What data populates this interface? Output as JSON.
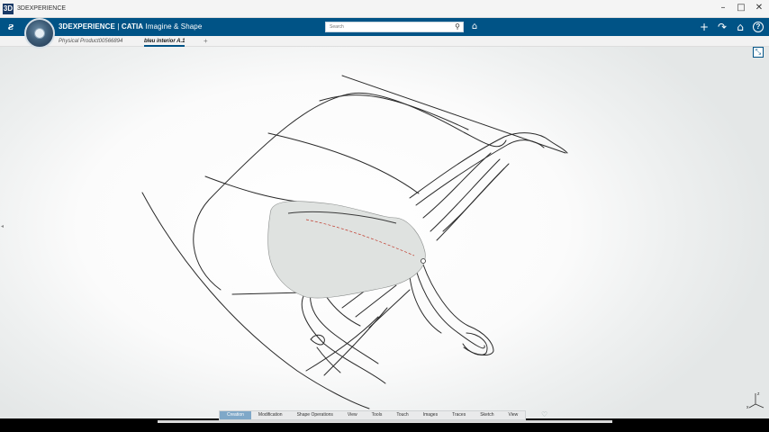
{
  "window": {
    "title": "3DEXPERIENCE",
    "controls": [
      "–",
      "□",
      "✕"
    ]
  },
  "appbar": {
    "brand_prefix": "3DEXPERIENCE",
    "brand_sep": " | ",
    "brand_product": "CATIA",
    "brand_app": " Imagine & Shape",
    "search_placeholder": "Search",
    "icons": [
      "ds-logo-icon",
      "compass-icon",
      "search-icon",
      "tag-icon",
      "plus-icon",
      "share-icon",
      "home-icon",
      "help-icon"
    ]
  },
  "tabs": [
    {
      "label": "Physical Product00566894",
      "active": false
    },
    {
      "label": "bleu interior A.1",
      "active": true
    }
  ],
  "tab_add": "+",
  "compass_axis": {
    "z_label": "z",
    "x_label": "x"
  },
  "action_bar": {
    "tabs": [
      "Creation",
      "Modification",
      "Shape Operations",
      "View",
      "Tools",
      "Touch",
      "Images",
      "Traces",
      "Sketch",
      "View"
    ],
    "active_index": 0
  },
  "colors": {
    "accent": "#005386",
    "active_tab": "#7fa8c8",
    "surface_fill": "#dfe2e0",
    "trace_red": "#c0392b"
  }
}
